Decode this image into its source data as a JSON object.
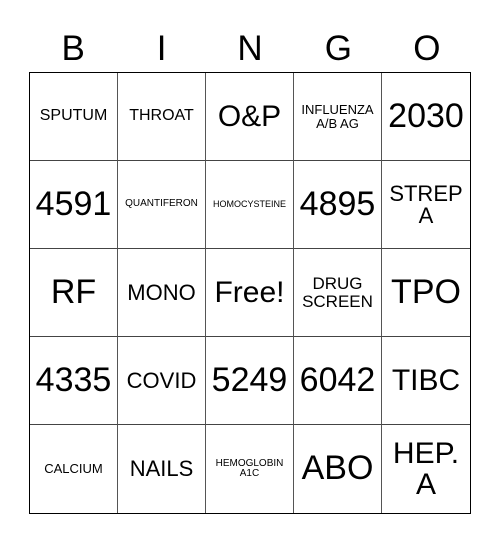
{
  "header": {
    "letters": [
      "B",
      "I",
      "N",
      "G",
      "O"
    ]
  },
  "grid": {
    "cells": [
      [
        "SPUTUM",
        "THROAT",
        "O&P",
        "INFLUENZA A/B AG",
        "2030"
      ],
      [
        "4591",
        "QUANTIFERON",
        "HOMOCYSTEINE",
        "4895",
        "STREP A"
      ],
      [
        "RF",
        "MONO",
        "Free!",
        "DRUG SCREEN",
        "TPO"
      ],
      [
        "4335",
        "COVID",
        "5249",
        "6042",
        "TIBC"
      ],
      [
        "CALCIUM",
        "NAILS",
        "HEMOGLOBIN A1C",
        "ABO",
        "HEP. A"
      ]
    ],
    "free_space": {
      "row": 2,
      "col": 2,
      "label": "Free!"
    }
  }
}
